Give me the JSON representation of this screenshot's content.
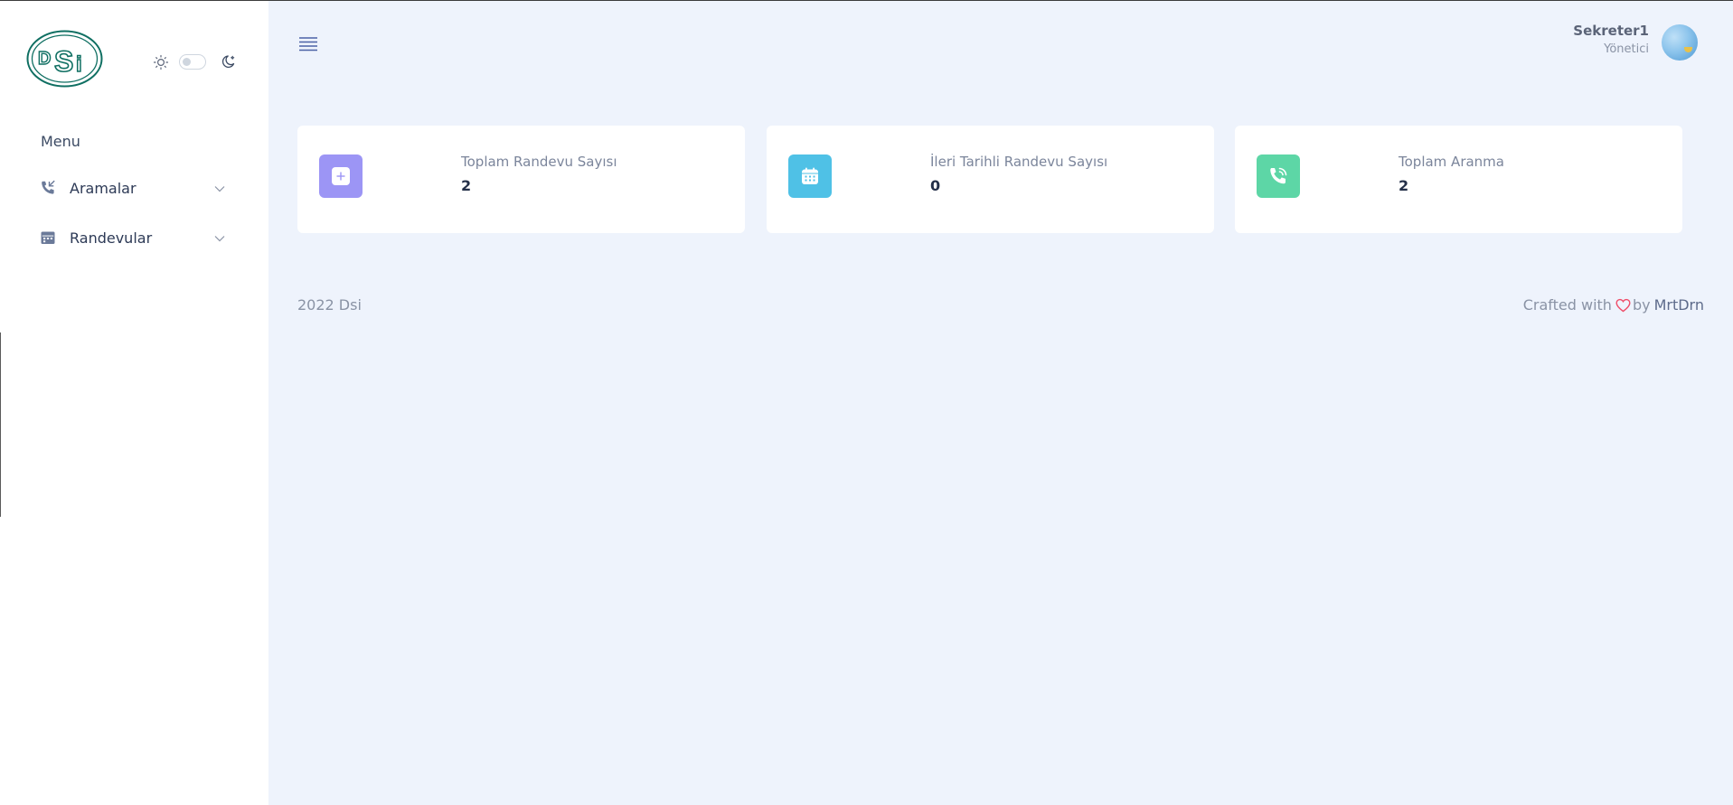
{
  "brand": {
    "logo_text": "DSi",
    "logo_color": "#0f6f62"
  },
  "theme": {
    "light_icon": "sun-icon",
    "dark_icon": "moon-icon",
    "dark_mode": false
  },
  "sidebar": {
    "menu_title": "Menu",
    "items": [
      {
        "label": "Aramalar",
        "icon": "phone-incoming-icon"
      },
      {
        "label": "Randevular",
        "icon": "calendar-icon"
      }
    ]
  },
  "header": {
    "menu_icon": "hamburger-icon",
    "user": {
      "name": "Sekreter1",
      "role": "Yönetici"
    }
  },
  "cards": [
    {
      "label": "Toplam Randevu Sayısı",
      "value": "2",
      "icon": "plus-square-icon",
      "color": "#9c95f5"
    },
    {
      "label": "İleri Tarihli Randevu Sayısı",
      "value": "0",
      "icon": "calendar-icon",
      "color": "#4fc1e6"
    },
    {
      "label": "Toplam Aranma",
      "value": "2",
      "icon": "phone-call-icon",
      "color": "#5dd6a6"
    }
  ],
  "footer": {
    "copyright": "2022 Dsi",
    "crafted_prefix": "Crafted with",
    "crafted_by": "by",
    "author": "MrtDrn",
    "heart_color": "#ef4e6a"
  }
}
